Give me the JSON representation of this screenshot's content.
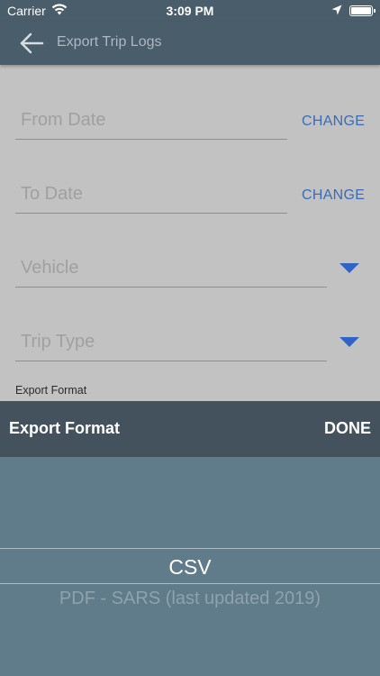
{
  "status_bar": {
    "carrier": "Carrier",
    "time": "3:09 PM",
    "icons": [
      "wifi-icon",
      "location-arrow-icon",
      "battery-icon"
    ]
  },
  "nav": {
    "back_icon": "arrow-left-icon",
    "title": "Export Trip Logs"
  },
  "form": {
    "from_date": {
      "placeholder": "From Date",
      "action": "CHANGE"
    },
    "to_date": {
      "placeholder": "To Date",
      "action": "CHANGE"
    },
    "vehicle": {
      "placeholder": "Vehicle",
      "icon": "dropdown-triangle-icon"
    },
    "trip_type": {
      "placeholder": "Trip Type",
      "icon": "dropdown-triangle-icon"
    },
    "export_format_label": "Export Format"
  },
  "picker": {
    "title": "Export Format",
    "done_label": "DONE",
    "options": [
      "CSV",
      "PDF - SARS (last updated 2019)"
    ],
    "selected": "CSV"
  },
  "colors": {
    "header": "#4a5d6b",
    "accent": "#3a6bb8",
    "overlay_background": "#c2c2c2",
    "picker_toolbar": "#44525d",
    "picker_background": "#607b89"
  }
}
